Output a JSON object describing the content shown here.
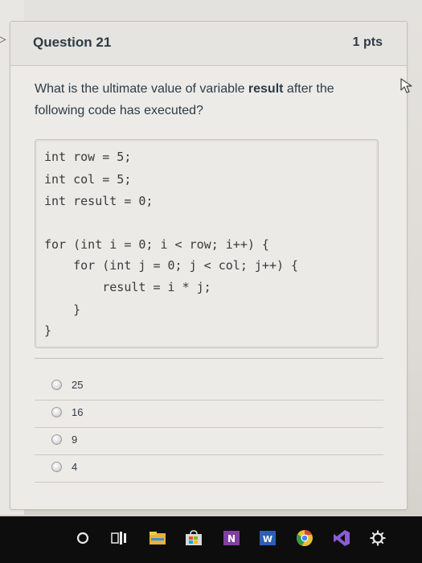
{
  "question": {
    "title": "Question 21",
    "points": "1 pts",
    "prompt_before": "What is the ultimate value of variable ",
    "prompt_bold": "result",
    "prompt_after": " after the following code has executed?",
    "code_lines": [
      "int row = 5;",
      "int col = 5;",
      "int result = 0;",
      "",
      "for (int i = 0; i < row; i++) {",
      "    for (int j = 0; j < col; j++) {",
      "        result = i * j;",
      "    }",
      "}"
    ]
  },
  "answers": [
    {
      "label": "25"
    },
    {
      "label": "16"
    },
    {
      "label": "9"
    },
    {
      "label": "4"
    }
  ],
  "taskbar": {
    "onenote_letter": "N",
    "word_letter": "W",
    "chrome_color": "#e8c132",
    "vs_color": "#8a5cd6",
    "onenote_color": "#8040a0",
    "word_color": "#2b5fb8"
  }
}
